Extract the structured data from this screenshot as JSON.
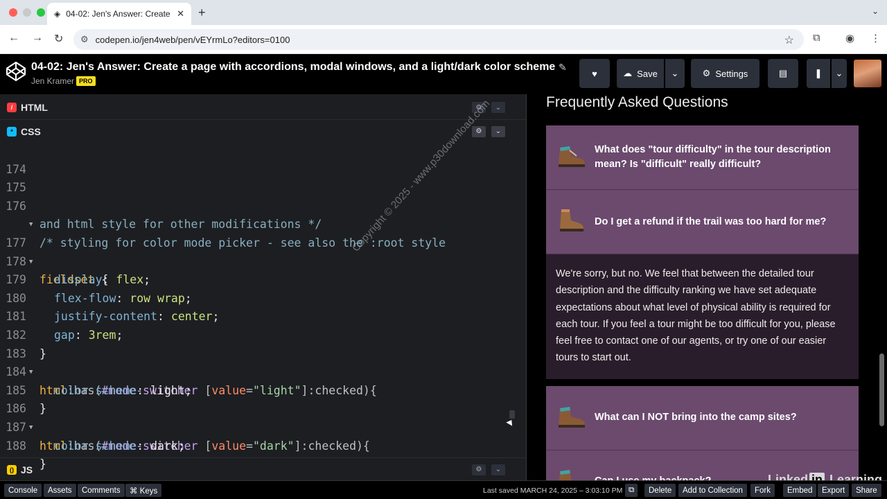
{
  "browser": {
    "tab_title": "04-02: Jen's Answer: Create",
    "url": "codepen.io/jen4web/pen/vEYrmLo?editors=0100"
  },
  "pen": {
    "title": "04-02: Jen's Answer: Create a page with accordions, modal windows, and a light/dark color scheme",
    "author": "Jen Kramer",
    "pro_label": "PRO",
    "save_label": "Save",
    "settings_label": "Settings"
  },
  "panels": {
    "html_label": "HTML",
    "css_label": "CSS",
    "js_label": "JS"
  },
  "code_lines": [
    {
      "n": "174"
    },
    {
      "n": "175"
    },
    {
      "n": "176",
      "text": "/* styling for color mode picker - see also the :root style"
    },
    {
      "n": "",
      "text": "and html style for other modifications */"
    },
    {
      "n": "177",
      "a": "fieldset",
      "b": " {"
    },
    {
      "n": "178",
      "a": "display",
      "b": ": ",
      "c": "flex",
      "d": ";"
    },
    {
      "n": "179",
      "a": "flex-flow",
      "b": ": ",
      "c": "row wrap",
      "d": ";"
    },
    {
      "n": "180",
      "a": "justify-content",
      "b": ": ",
      "c": "center",
      "d": ";"
    },
    {
      "n": "181",
      "a": "gap",
      "b": ": ",
      "c": "3rem",
      "d": ";"
    },
    {
      "n": "182",
      "text": "}"
    },
    {
      "n": "183",
      "a": "html",
      "b": ":has(",
      "c": "#mode-switcher",
      "d": " [",
      "e": "value",
      "f": "=",
      "g": "\"light\"",
      "h": "]:checked){"
    },
    {
      "n": "184",
      "a": "color-scheme",
      "b": ": ",
      "c": "light",
      "d": ";"
    },
    {
      "n": "185",
      "text": "}"
    },
    {
      "n": "186",
      "a": "html",
      "b": ":has(",
      "c": "#mode-switcher",
      "d": " [",
      "e": "value",
      "f": "=",
      "g": "\"dark\"",
      "h": "]:checked){"
    },
    {
      "n": "187",
      "a": "color-scheme",
      "b": ": ",
      "c": "dark",
      "d": ";"
    },
    {
      "n": "188",
      "text": "}"
    }
  ],
  "watermark": "Copyright © 2025 - www.p30download.com",
  "preview": {
    "heading": "Frequently Asked Questions",
    "faq": [
      {
        "q": "What does \"tour difficulty\" in the tour description mean? Is \"difficult\" really difficult?"
      },
      {
        "q": "Do I get a refund if the trail was too hard for me?"
      },
      {
        "a": "We're sorry, but no. We feel that between the detailed tour description and the difficulty ranking we have set adequate expectations about what level of physical ability is required for each tour. If you feel a tour might be too difficult for you, please feel free to contact one of our agents, or try one of our easier tours to start out."
      },
      {
        "q": "What can I NOT bring into the camp sites?"
      },
      {
        "q": "Can I use my backpack?"
      }
    ]
  },
  "linkedin": {
    "part1": "Linked",
    "part2": "in",
    "part3": " Learning"
  },
  "footer": {
    "console": "Console",
    "assets": "Assets",
    "comments": "Comments",
    "keys": "⌘ Keys",
    "last_saved": "Last saved MARCH 24, 2025 – 3:03:10 PM",
    "delete": "Delete",
    "add_collection": "Add to Collection",
    "fork": "Fork",
    "embed": "Embed",
    "export": "Export",
    "share": "Share"
  },
  "colors": {
    "accordion": "#6b4a6e",
    "answer_bg": "#2a1d2b",
    "editor_bg": "#1d1e22"
  }
}
